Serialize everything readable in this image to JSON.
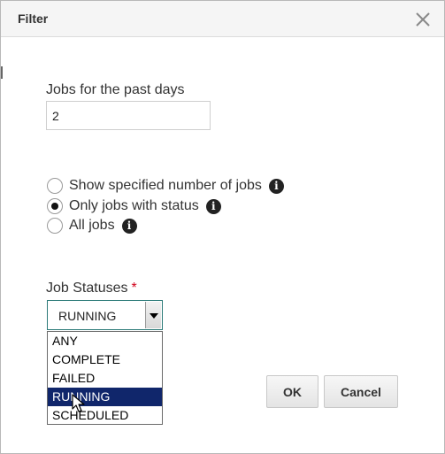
{
  "dialog": {
    "title": "Filter",
    "close_icon": "close-icon"
  },
  "days": {
    "label": "Jobs for the past days",
    "value": "2"
  },
  "modes": [
    {
      "label": "Show specified number of jobs",
      "checked": false,
      "icon": "info-icon"
    },
    {
      "label": "Only jobs with status",
      "checked": true,
      "icon": "info-icon"
    },
    {
      "label": "All jobs",
      "checked": false,
      "icon": "info-icon"
    }
  ],
  "statuses": {
    "label": "Job Statuses",
    "required_mark": "*",
    "selected": "RUNNING",
    "options": [
      "ANY",
      "COMPLETE",
      "FAILED",
      "RUNNING",
      "SCHEDULED"
    ],
    "highlighted": "RUNNING"
  },
  "buttons": {
    "ok": "OK",
    "cancel": "Cancel"
  },
  "colors": {
    "required": "#d0021b",
    "selection_highlight": "#10266b",
    "select_border": "#2b7a78"
  }
}
